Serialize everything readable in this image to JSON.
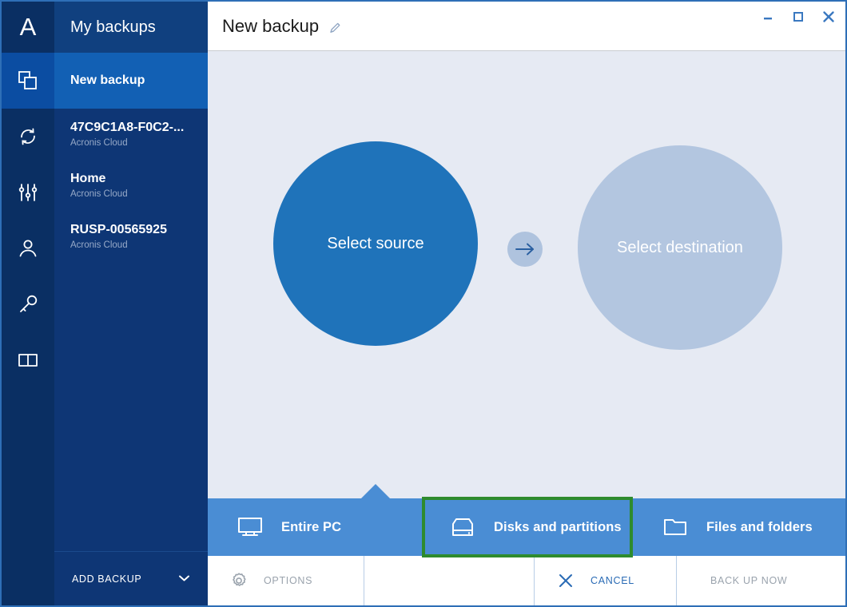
{
  "window": {
    "controls": [
      {
        "name": "minimize",
        "glyph": "minimize-icon"
      },
      {
        "name": "maximize",
        "glyph": "maximize-icon"
      },
      {
        "name": "close",
        "glyph": "close-icon"
      }
    ],
    "accent_blue": "#2e6fb7"
  },
  "icon_rail": {
    "logo_letter": "A",
    "items": [
      {
        "icon": "backup-stacked-squares-icon",
        "active": true
      },
      {
        "icon": "sync-circular-arrows-icon",
        "active": false
      },
      {
        "icon": "tools-sliders-icon",
        "active": false
      },
      {
        "icon": "account-person-icon",
        "active": false
      },
      {
        "icon": "key-icon",
        "active": false
      },
      {
        "icon": "book-icon",
        "active": false
      }
    ]
  },
  "sidebar": {
    "header": "My backups",
    "items": [
      {
        "title": "New backup",
        "subtitle": "",
        "selected": true
      },
      {
        "title": "47C9C1A8-F0C2-...",
        "subtitle": "Acronis Cloud",
        "selected": false
      },
      {
        "title": "Home",
        "subtitle": "Acronis Cloud",
        "selected": false
      },
      {
        "title": "RUSP-00565925",
        "subtitle": "Acronis Cloud",
        "selected": false
      }
    ],
    "add_backup_label": "ADD BACKUP",
    "add_backup_chevron": "chevron-down-icon"
  },
  "titlebar": {
    "title": "New backup",
    "edit_icon": "pencil-edit-icon"
  },
  "canvas": {
    "source_label": "Select source",
    "arrow_icon": "arrow-right-icon",
    "destination_label": "Select destination",
    "source_color": "#1f73ba",
    "destination_color": "#b3c6e0"
  },
  "tiles": {
    "highlight_color": "#2e8b2e",
    "items": [
      {
        "label": "Entire PC",
        "icon": "monitor-icon",
        "highlighted": false
      },
      {
        "label": "Disks and partitions",
        "icon": "hard-disk-icon",
        "highlighted": true
      },
      {
        "label": "Files and folders",
        "icon": "folder-icon",
        "highlighted": false
      }
    ]
  },
  "toolbar": {
    "options_label": "OPTIONS",
    "options_icon": "gear-icon",
    "cancel_label": "CANCEL",
    "cancel_icon": "close-x-icon",
    "backup_now_label": "BACK UP NOW"
  }
}
